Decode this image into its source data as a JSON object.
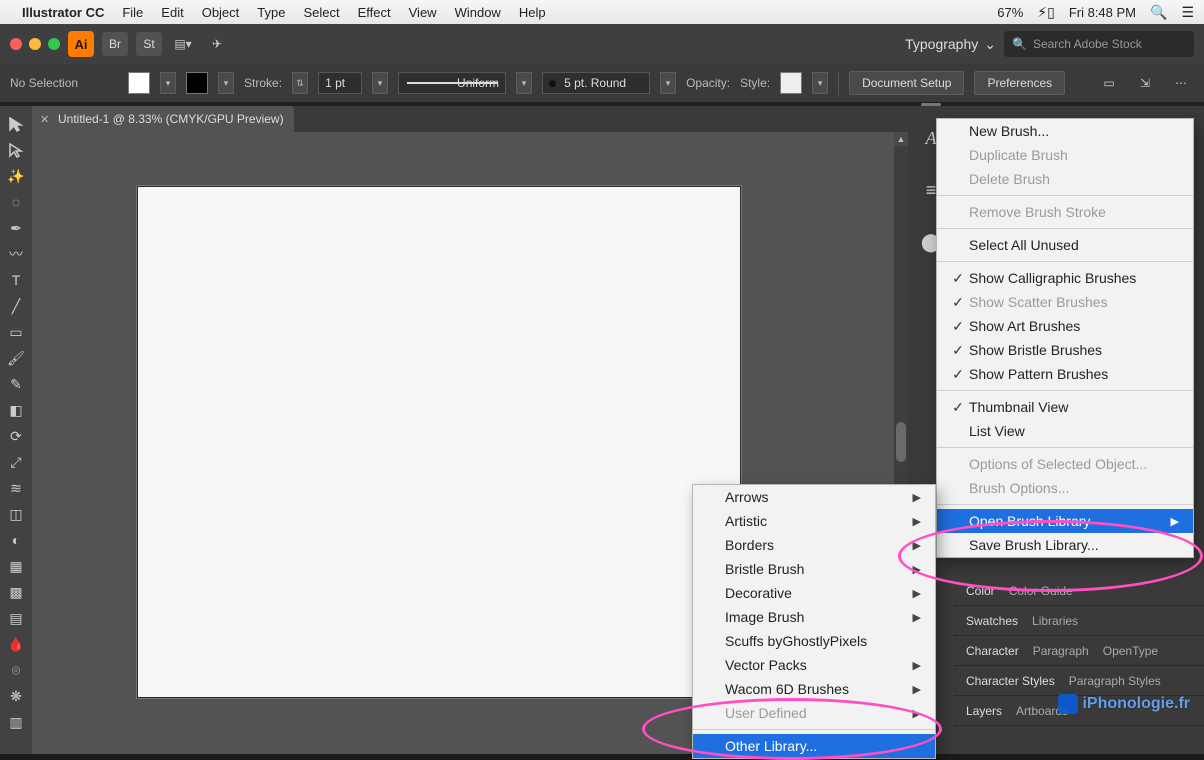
{
  "mac_menubar": {
    "apple": "",
    "app": "Illustrator CC",
    "items": [
      "File",
      "Edit",
      "Object",
      "Type",
      "Select",
      "Effect",
      "View",
      "Window",
      "Help"
    ],
    "battery_pct": "67%",
    "datetime": "Fri 8:48 PM"
  },
  "top_bar": {
    "ai_logo_text": "Ai",
    "workspace": "Typography",
    "search_placeholder": "Search Adobe Stock"
  },
  "option_bar": {
    "selection_state": "No Selection",
    "stroke_label": "Stroke:",
    "stroke_weight": "1 pt",
    "profile_label": "Uniform",
    "brush_label": "5 pt. Round",
    "opacity_label": "Opacity:",
    "style_label": "Style:",
    "btn_docsetup": "Document Setup",
    "btn_prefs": "Preferences"
  },
  "document": {
    "tab_title": "Untitled-1 @ 8.33% (CMYK/GPU Preview)"
  },
  "brush_panel_menu": {
    "items": [
      {
        "label": "New Brush...",
        "enabled": true
      },
      {
        "label": "Duplicate Brush",
        "enabled": false
      },
      {
        "label": "Delete Brush",
        "enabled": false
      },
      {
        "sep": true
      },
      {
        "label": "Remove Brush Stroke",
        "enabled": false
      },
      {
        "sep": true
      },
      {
        "label": "Select All Unused",
        "enabled": true
      },
      {
        "sep": true
      },
      {
        "label": "Show Calligraphic Brushes",
        "enabled": true,
        "checked": true
      },
      {
        "label": "Show Scatter Brushes",
        "enabled": false,
        "checked": true
      },
      {
        "label": "Show Art Brushes",
        "enabled": true,
        "checked": true
      },
      {
        "label": "Show Bristle Brushes",
        "enabled": true,
        "checked": true
      },
      {
        "label": "Show Pattern Brushes",
        "enabled": true,
        "checked": true
      },
      {
        "sep": true
      },
      {
        "label": "Thumbnail View",
        "enabled": true,
        "checked": true
      },
      {
        "label": "List View",
        "enabled": true
      },
      {
        "sep": true
      },
      {
        "label": "Options of Selected Object...",
        "enabled": false
      },
      {
        "label": "Brush Options...",
        "enabled": false
      },
      {
        "sep": true
      },
      {
        "label": "Open Brush Library",
        "enabled": true,
        "submenu": true,
        "highlight": true
      },
      {
        "label": "Save Brush Library...",
        "enabled": true
      }
    ]
  },
  "brush_library_submenu": {
    "items": [
      {
        "label": "Arrows",
        "submenu": true
      },
      {
        "label": "Artistic",
        "submenu": true
      },
      {
        "label": "Borders",
        "submenu": true
      },
      {
        "label": "Bristle Brush",
        "submenu": true
      },
      {
        "label": "Decorative",
        "submenu": true
      },
      {
        "label": "Image Brush",
        "submenu": true
      },
      {
        "label": "Scuffs byGhostlyPixels"
      },
      {
        "label": "Vector Packs",
        "submenu": true
      },
      {
        "label": "Wacom 6D Brushes",
        "submenu": true
      },
      {
        "label": "User Defined",
        "submenu": true,
        "enabled": false
      },
      {
        "sep": true
      },
      {
        "label": "Other Library...",
        "highlight": true
      }
    ]
  },
  "panel_tabs": {
    "row1": [
      "Color",
      "Color Guide"
    ],
    "row2": [
      "Swatches",
      "Libraries"
    ],
    "row3": [
      "Character",
      "Paragraph",
      "OpenType"
    ],
    "row4": [
      "Character Styles",
      "Paragraph Styles"
    ],
    "row5": [
      "Layers",
      "Artboards"
    ]
  },
  "watermark_text": "iPhonologie.fr"
}
